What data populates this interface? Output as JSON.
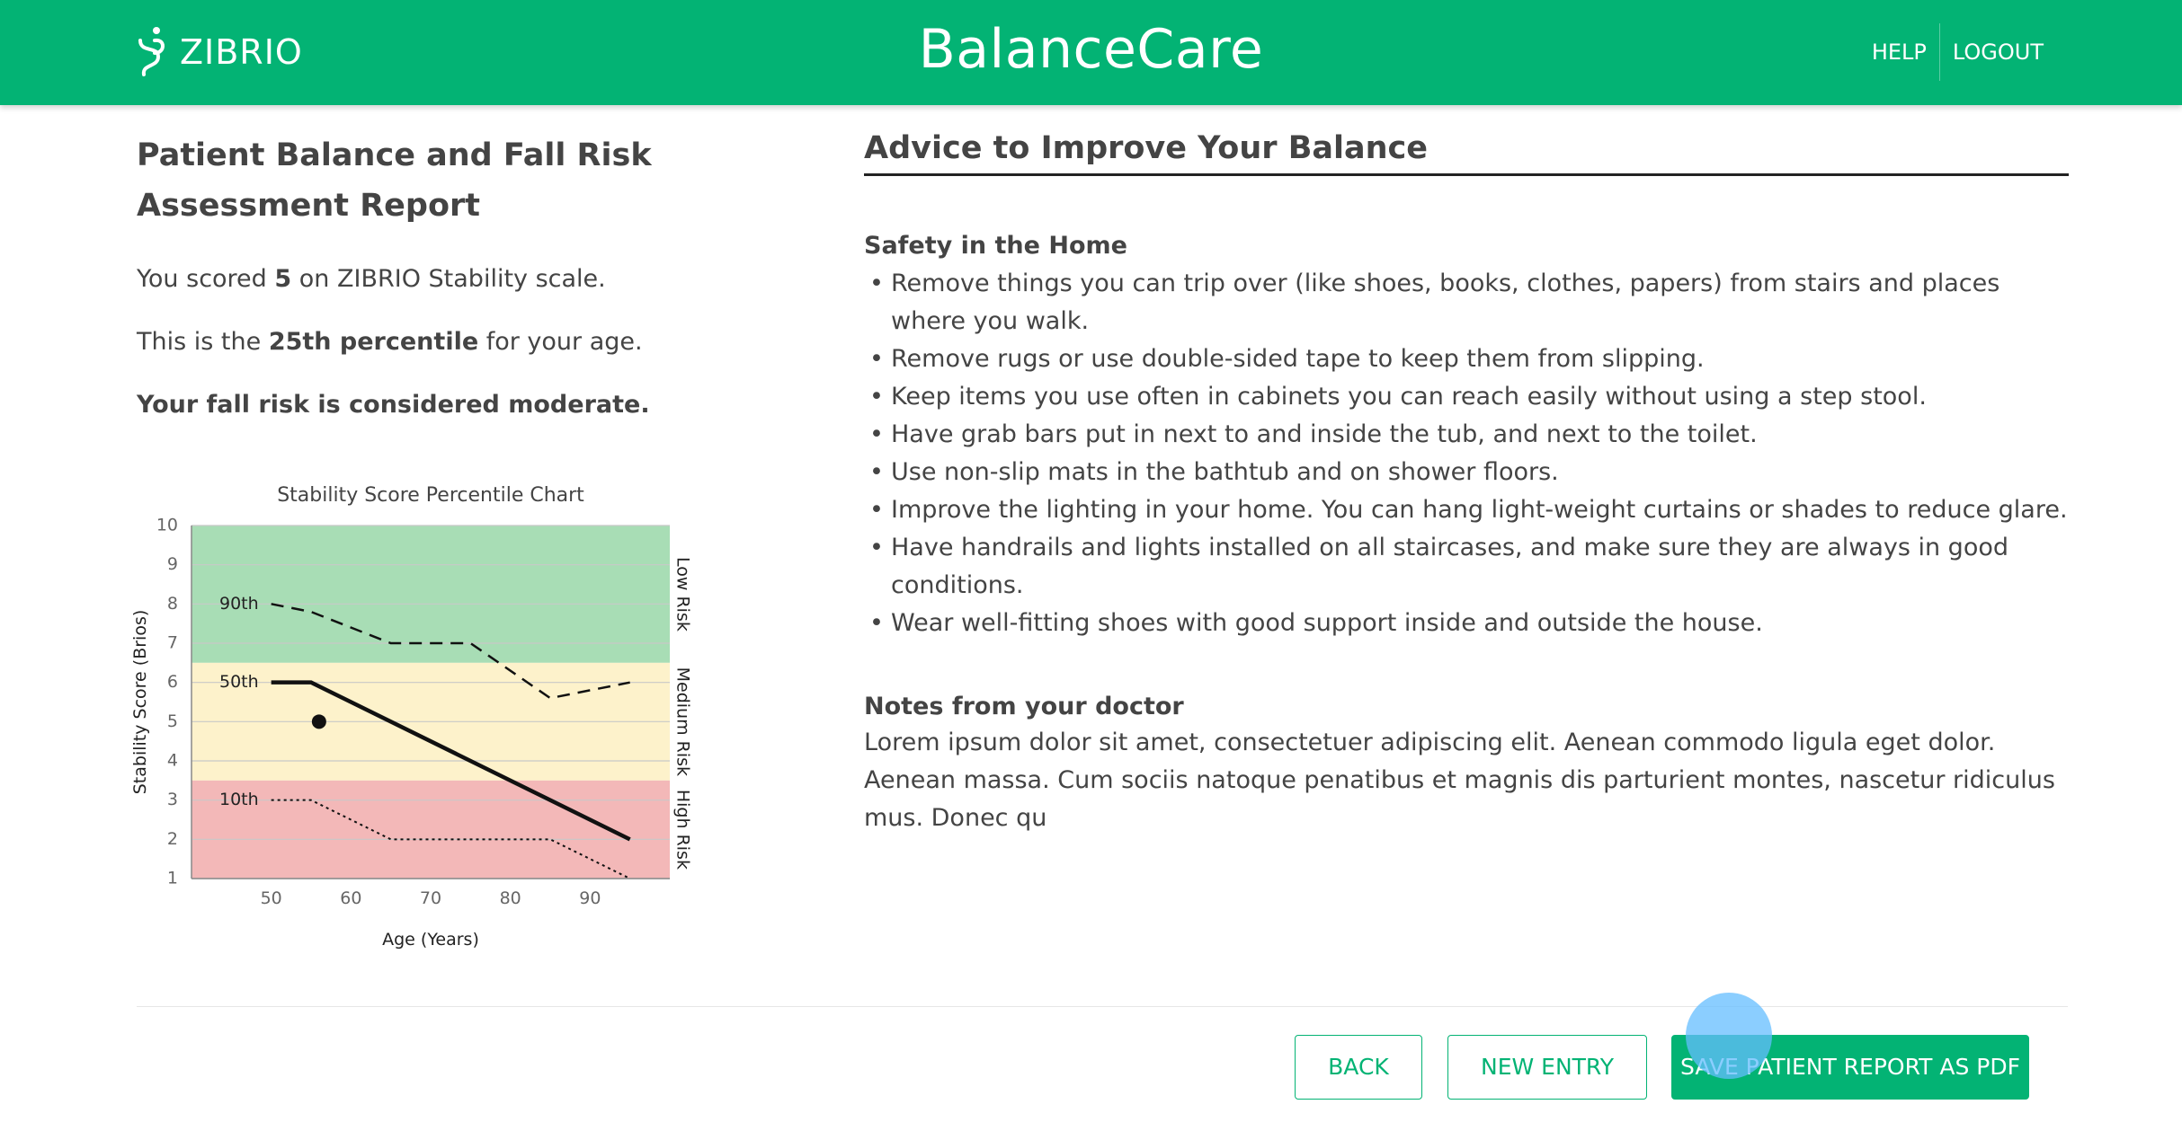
{
  "header": {
    "logo_text": "ZIBRIO",
    "app_title": "BalanceCare",
    "nav": {
      "help": "HELP",
      "logout": "LOGOUT"
    },
    "bg_color": "#03b374"
  },
  "report": {
    "title": "Patient Balance and Fall Risk Assessment Report",
    "score_prefix": "You scored ",
    "score_value": "5",
    "score_suffix": " on ZIBRIO Stability scale.",
    "percentile_prefix": "This is the ",
    "percentile_value": "25th percentile",
    "percentile_suffix": " for your age.",
    "risk_text": "Your fall risk is considered moderate."
  },
  "advice": {
    "title": "Advice to Improve Your Balance",
    "section_title": "Safety in the Home",
    "tips": [
      "Remove things you can trip over (like shoes, books, clothes, papers) from stairs and places where you walk.",
      "Remove rugs or use double-sided tape to keep them from slipping.",
      "Keep items you use often in cabinets you can reach easily without using a step stool.",
      "Have grab bars put in next to and inside the tub, and next to the toilet.",
      "Use non-slip mats in the bathtub and on shower floors.",
      "Improve the lighting in your home. You can hang light-weight curtains or shades to reduce glare.",
      "Have handrails and lights installed on all staircases, and make sure they are always in good conditions.",
      "Wear well-fitting shoes with good support inside and outside the house."
    ],
    "notes_title": "Notes from your doctor",
    "notes_text": "Lorem ipsum dolor sit amet, consectetuer adipiscing elit. Aenean commodo ligula eget dolor. Aenean massa. Cum sociis natoque penatibus et magnis dis parturient montes, nascetur ridiculus mus. Donec qu"
  },
  "footer": {
    "back": "BACK",
    "new_entry": "NEW ENTRY",
    "save": "SAVE PATIENT REPORT AS PDF"
  },
  "chart_data": {
    "type": "line",
    "title": "Stability Score Percentile Chart",
    "xlabel": "Age (Years)",
    "ylabel": "Stability Score (Brios)",
    "xlim": [
      40,
      100
    ],
    "ylim": [
      1,
      10
    ],
    "x_ticks": [
      50,
      60,
      70,
      80,
      90
    ],
    "y_ticks": [
      1,
      2,
      3,
      4,
      5,
      6,
      7,
      8,
      9,
      10
    ],
    "grid": true,
    "risk_bands": [
      {
        "label": "Low Risk",
        "y_range": [
          6.5,
          10
        ],
        "color": "#a8ddb5"
      },
      {
        "label": "Medium Risk",
        "y_range": [
          3.5,
          6.5
        ],
        "color": "#fdf2cb"
      },
      {
        "label": "High Risk",
        "y_range": [
          1,
          3.5
        ],
        "color": "#f3b8b8"
      }
    ],
    "series": [
      {
        "name": "90th",
        "style": "dashed",
        "x": [
          50,
          55,
          65,
          75,
          85,
          95
        ],
        "y": [
          8,
          7.8,
          7,
          7,
          5.6,
          6
        ]
      },
      {
        "name": "50th",
        "style": "solid",
        "x": [
          50,
          55,
          95
        ],
        "y": [
          6,
          6,
          2
        ]
      },
      {
        "name": "10th",
        "style": "dotted",
        "x": [
          50,
          55,
          65,
          85,
          95
        ],
        "y": [
          3,
          3,
          2,
          2,
          1
        ]
      }
    ],
    "patient_point": {
      "x": 56,
      "y": 5
    }
  }
}
